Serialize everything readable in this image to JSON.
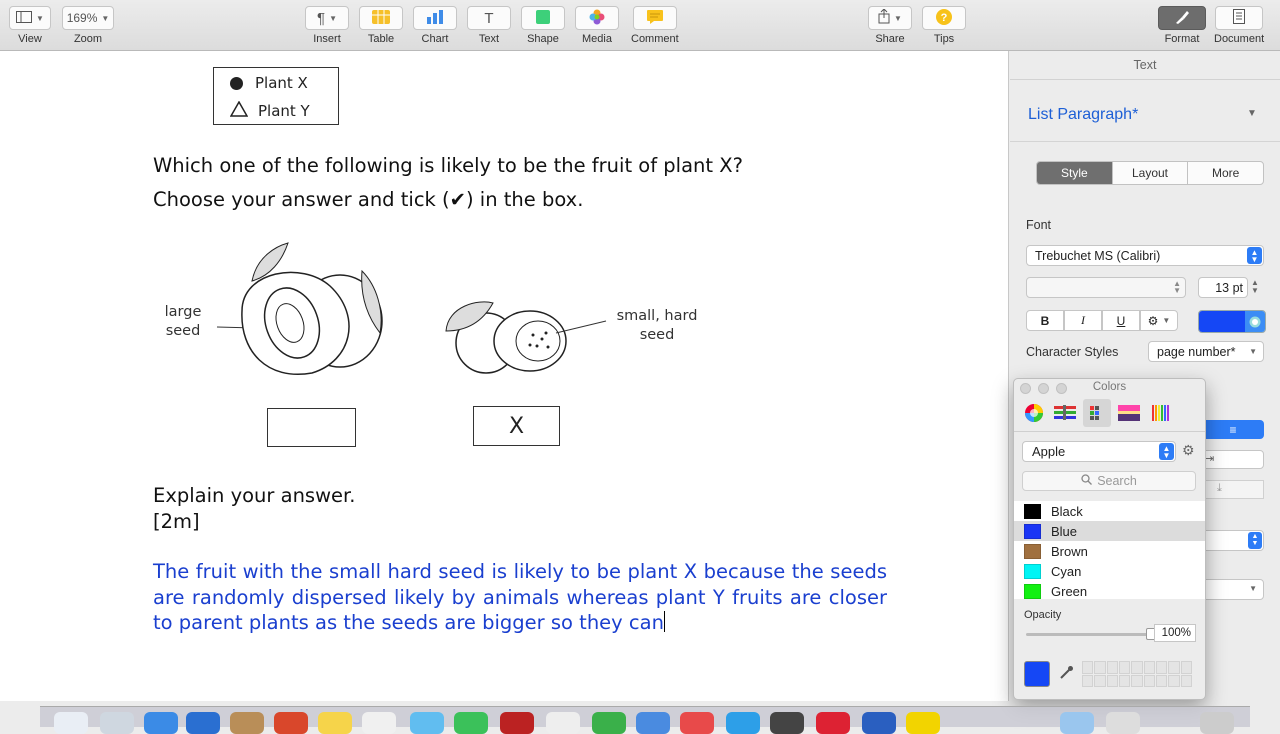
{
  "toolbar": {
    "view": {
      "label": "View"
    },
    "zoom": {
      "value": "169%",
      "label": "Zoom"
    },
    "insert": {
      "glyph": "¶",
      "label": "Insert"
    },
    "table": {
      "label": "Table"
    },
    "chart": {
      "label": "Chart"
    },
    "text": {
      "glyph": "T",
      "label": "Text"
    },
    "shape": {
      "label": "Shape"
    },
    "media": {
      "label": "Media"
    },
    "comment": {
      "label": "Comment"
    },
    "share": {
      "label": "Share"
    },
    "tips": {
      "label": "Tips"
    },
    "format": {
      "label": "Format"
    },
    "document": {
      "label": "Document"
    }
  },
  "document": {
    "legend": {
      "plant_x": "Plant X",
      "plant_y": "Plant Y"
    },
    "question_line1": "Which one of the following is likely to be the fruit of plant X?",
    "question_line2": "Choose your answer and tick (✔) in the box.",
    "figure": {
      "left_label_line1": "large",
      "left_label_line2": "seed",
      "right_label_line1": "small, hard",
      "right_label_line2": "seed",
      "left_box": "",
      "right_box": "X"
    },
    "explain": "Explain your answer.",
    "marks": "[2m]",
    "answer": "The fruit with the small hard seed is likely to be plant X because the seeds are randomly dispersed likely by animals whereas plant Y fruits are closer to parent plants as the seeds are bigger so they can"
  },
  "inspector": {
    "tab": "Text",
    "paragraph_style": "List Paragraph*",
    "segments": [
      "Style",
      "Layout",
      "More"
    ],
    "font_label": "Font",
    "font_name": "Trebuchet MS (Calibri)",
    "font_size": "13 pt",
    "bold": "B",
    "italic": "I",
    "underline": "U",
    "text_color": "#1547f5",
    "char_styles_label": "Character Styles",
    "char_style_value": "page number*"
  },
  "colors_panel": {
    "title": "Colors",
    "palette": "Apple",
    "search_placeholder": "Search",
    "colors": [
      {
        "name": "Black",
        "hex": "#000000"
      },
      {
        "name": "Blue",
        "hex": "#1a35f5"
      },
      {
        "name": "Brown",
        "hex": "#a0703f"
      },
      {
        "name": "Cyan",
        "hex": "#00f5f5"
      },
      {
        "name": "Green",
        "hex": "#12f012"
      }
    ],
    "selected": "Blue",
    "opacity_label": "Opacity",
    "opacity_value": "100%",
    "current_color": "#1547f5"
  }
}
